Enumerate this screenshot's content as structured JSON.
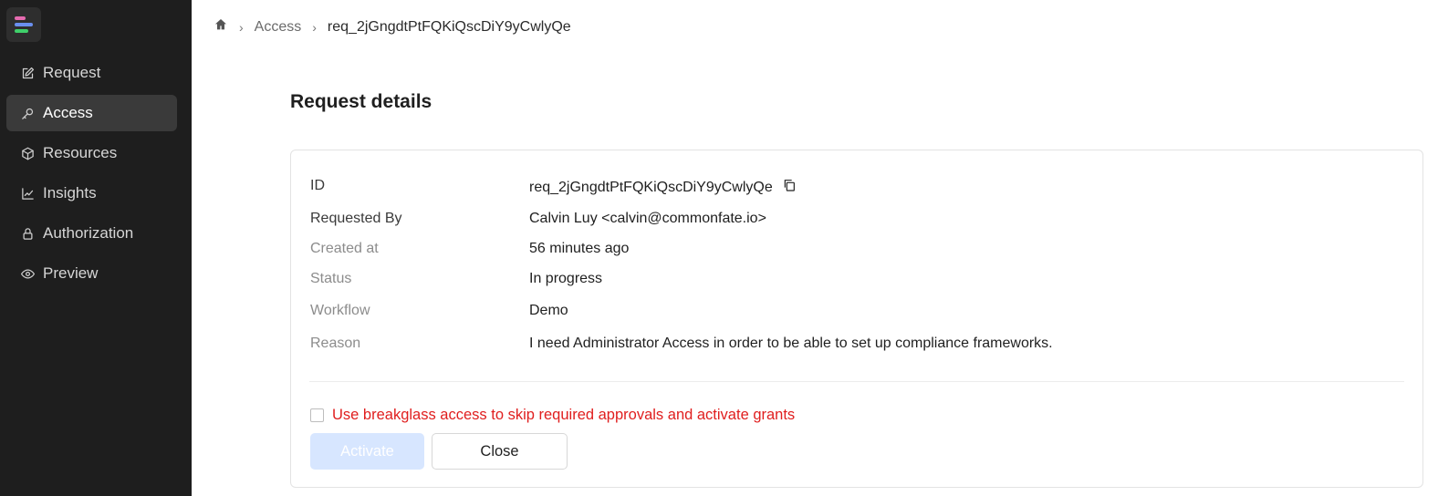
{
  "sidebar": {
    "items": [
      {
        "label": "Request",
        "icon": "edit-icon"
      },
      {
        "label": "Access",
        "icon": "key-icon",
        "active": true
      },
      {
        "label": "Resources",
        "icon": "cube-icon"
      },
      {
        "label": "Insights",
        "icon": "chart-icon"
      },
      {
        "label": "Authorization",
        "icon": "lock-icon"
      },
      {
        "label": "Preview",
        "icon": "eye-icon"
      }
    ]
  },
  "breadcrumb": {
    "section": "Access",
    "current": "req_2jGngdtPtFQKiQscDiY9yCwlyQe"
  },
  "page": {
    "title": "Request details"
  },
  "details": {
    "id_label": "ID",
    "id_value": "req_2jGngdtPtFQKiQscDiY9yCwlyQe",
    "requested_by_label": "Requested By",
    "requested_by_value": "Calvin Luy <calvin@commonfate.io>",
    "created_label": "Created at",
    "created_value": "56 minutes ago",
    "status_label": "Status",
    "status_value": "In progress",
    "workflow_label": "Workflow",
    "workflow_value": "Demo",
    "reason_label": "Reason",
    "reason_value": "I need Administrator Access in order to be able to set up compliance frameworks."
  },
  "actions": {
    "breakglass_label": "Use breakglass access to skip required approvals and activate grants",
    "breakglass_checked": false,
    "activate_label": "Activate",
    "close_label": "Close"
  },
  "colors": {
    "sidebar_bg": "#1e1e1e",
    "active_item_bg": "#3a3a3a",
    "breakglass_text": "#e01e1e",
    "activate_disabled_bg": "#d7e6ff"
  }
}
